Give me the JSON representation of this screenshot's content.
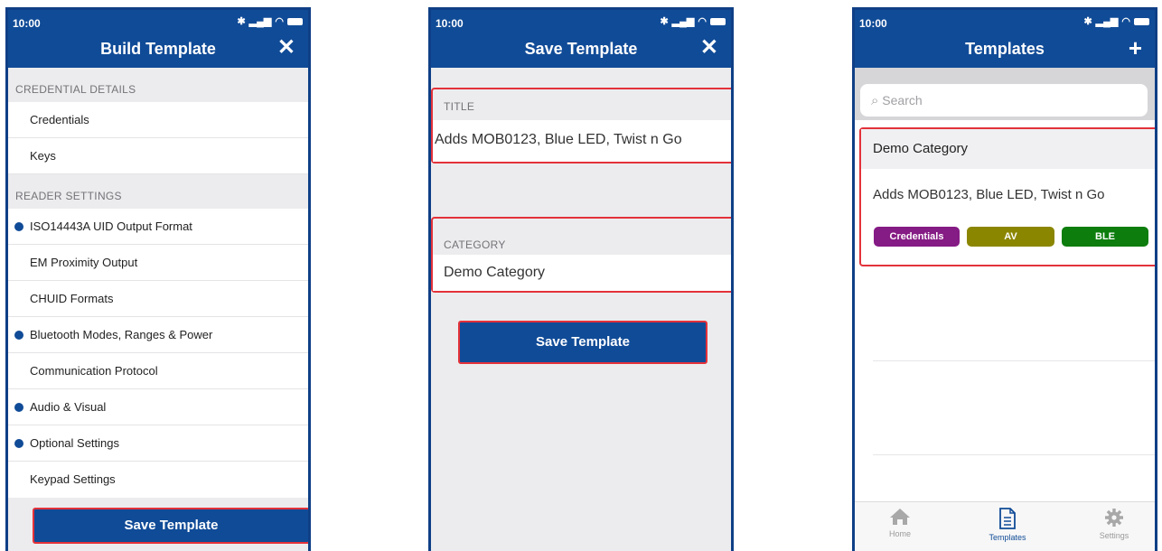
{
  "status_bar": {
    "time": "10:00"
  },
  "colors": {
    "brand_blue": "#104b97",
    "highlight_red": "#e3323a",
    "tag_credentials": "#851b84",
    "tag_av": "#8b8600",
    "tag_ble": "#0d7d0d"
  },
  "screen1": {
    "title": "Build Template",
    "close_icon": "close-icon",
    "section_credential": "CREDENTIAL DETAILS",
    "credential_items": [
      {
        "label": "Credentials"
      },
      {
        "label": "Keys"
      }
    ],
    "section_reader": "READER SETTINGS",
    "reader_items": [
      {
        "label": "ISO14443A UID Output Format",
        "modified": true
      },
      {
        "label": "EM Proximity Output",
        "modified": false
      },
      {
        "label": "CHUID Formats",
        "modified": false
      },
      {
        "label": "Bluetooth Modes, Ranges & Power",
        "modified": true
      },
      {
        "label": "Communication Protocol",
        "modified": false
      },
      {
        "label": "Audio & Visual",
        "modified": true
      },
      {
        "label": "Optional Settings",
        "modified": true
      },
      {
        "label": "Keypad Settings",
        "modified": false
      }
    ],
    "save_button": "Save Template"
  },
  "screen2": {
    "title": "Save Template",
    "close_icon": "close-icon",
    "title_label": "TITLE",
    "title_value": "Adds MOB0123, Blue LED, Twist n Go",
    "category_label": "CATEGORY",
    "category_value": "Demo Category",
    "save_button": "Save Template"
  },
  "screen3": {
    "title": "Templates",
    "add_icon": "plus-icon",
    "search_placeholder": "Search",
    "category": "Demo Category",
    "template_name": "Adds MOB0123, Blue LED, Twist n Go",
    "tags": [
      "Credentials",
      "AV",
      "BLE"
    ],
    "tabs": [
      {
        "label": "Home",
        "icon": "home-icon"
      },
      {
        "label": "Templates",
        "icon": "document-icon",
        "active": true
      },
      {
        "label": "Settings",
        "icon": "gear-icon"
      }
    ]
  }
}
